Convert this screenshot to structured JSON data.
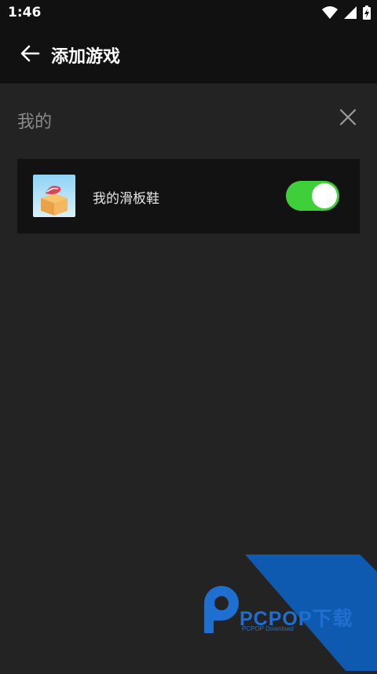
{
  "status_bar": {
    "time": "1:46",
    "icons": [
      "wifi-icon",
      "signal-icon",
      "battery-charging-icon"
    ]
  },
  "app_bar": {
    "back_icon": "arrow-left-icon",
    "title": "添加游戏"
  },
  "section": {
    "label": "我的",
    "close_icon": "close-icon"
  },
  "games": [
    {
      "name": "我的滑板鞋",
      "icon": "game-thumbnail",
      "enabled": true
    }
  ],
  "watermark": {
    "text": "PCPOP下载",
    "subtext": "PCPOP Download"
  },
  "colors": {
    "background": "#232323",
    "bar": "#111111",
    "card": "#121212",
    "toggle_on": "#3ecf3a",
    "watermark": "#0d5ab0"
  }
}
